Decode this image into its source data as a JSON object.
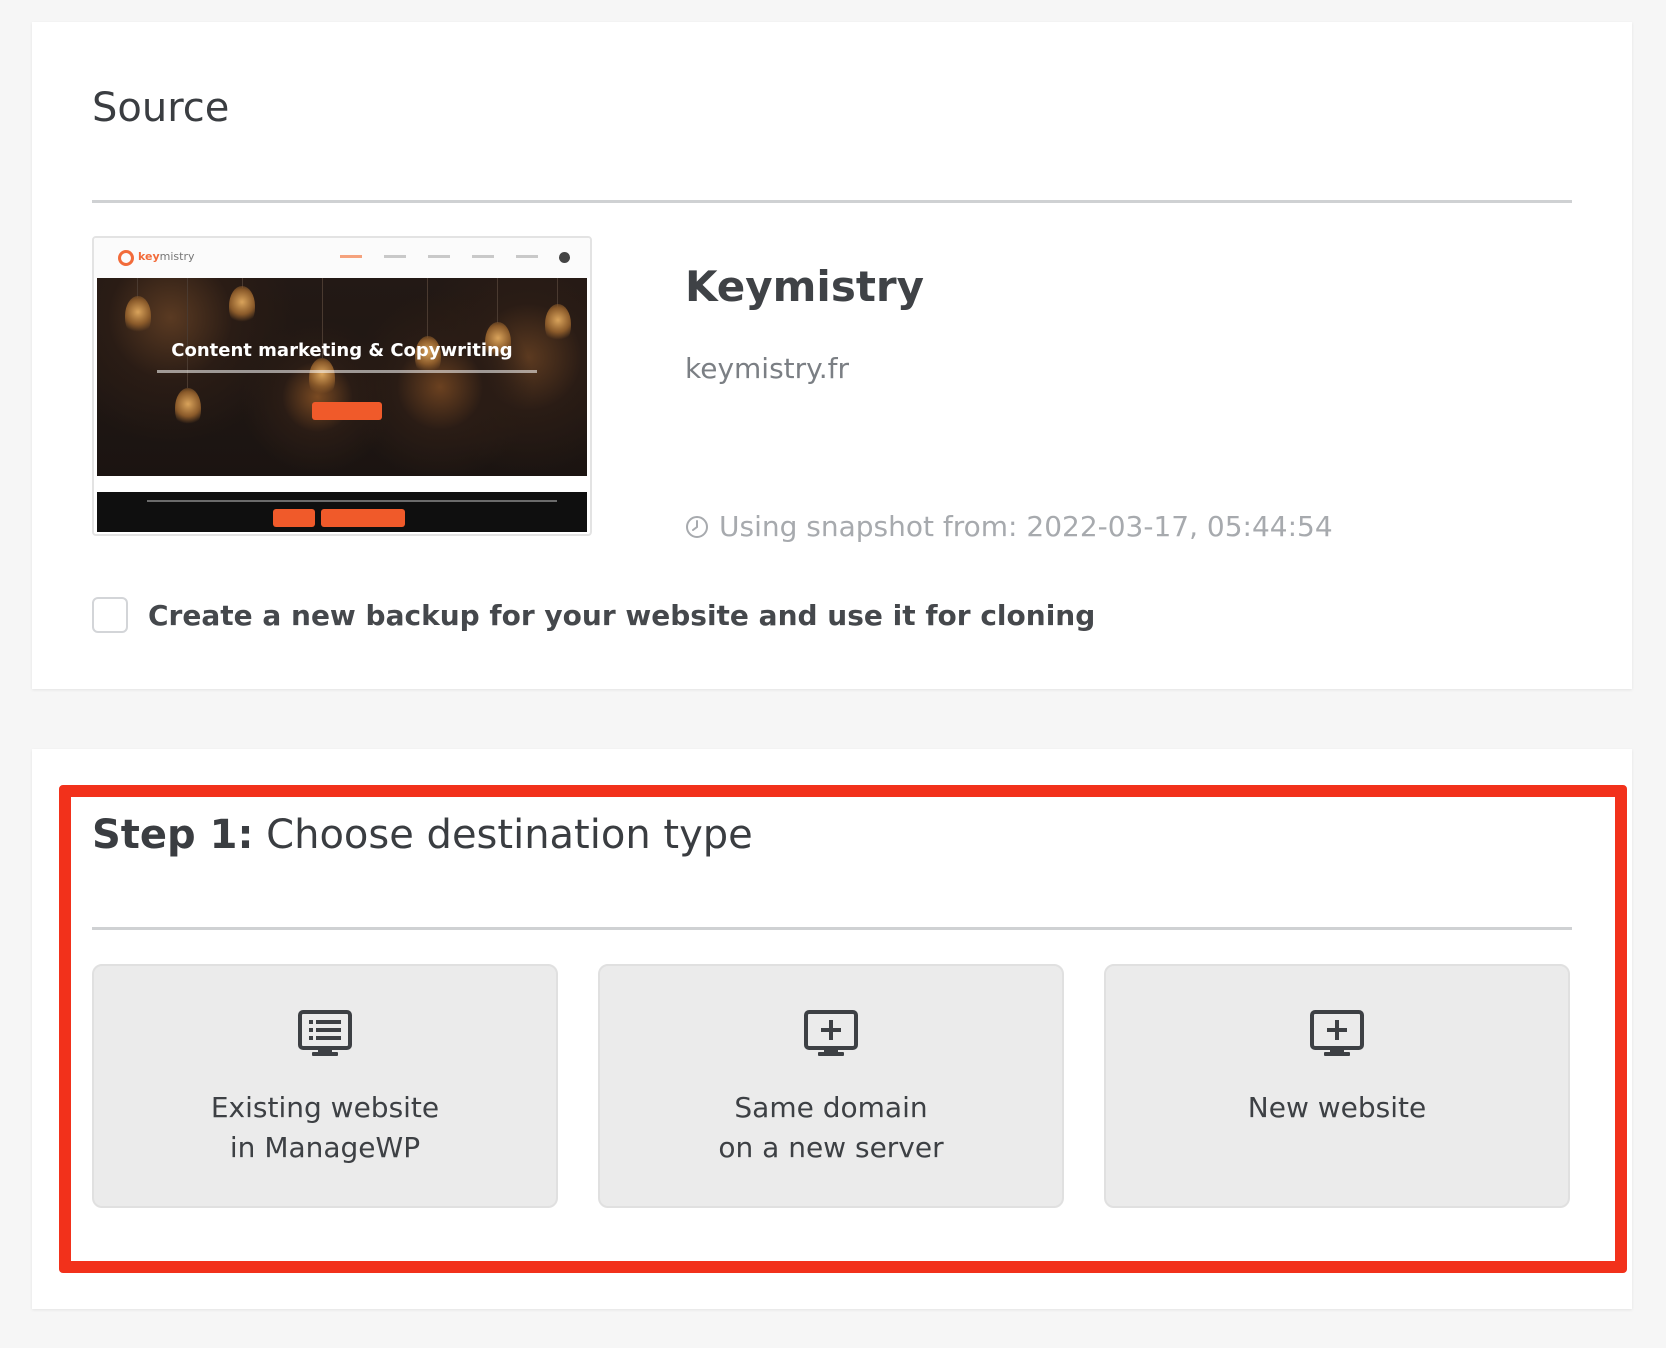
{
  "source": {
    "title": "Source",
    "site_name": "Keymistry",
    "domain": "keymistry.fr",
    "snapshot_text": "Using snapshot from: 2022-03-17, 05:44:54",
    "backup_checkbox": {
      "label": "Create a new backup for your website and use it for cloning",
      "checked": false
    },
    "thumbnail": {
      "logo_prefix": "key",
      "logo_suffix": "mistry",
      "headline": "Content marketing & Copywriting"
    }
  },
  "step": {
    "title_bold": "Step 1:",
    "title_rest": " Choose destination type",
    "options": [
      {
        "icon": "list-monitor-icon",
        "line1": "Existing website",
        "line2": "in ManageWP"
      },
      {
        "icon": "add-monitor-icon",
        "line1": "Same domain",
        "line2": "on a new server"
      },
      {
        "icon": "add-monitor-icon",
        "line1": "New website",
        "line2": ""
      }
    ]
  },
  "colors": {
    "highlight": "#f2311b",
    "accent": "#f05a2a",
    "option_bg": "#ebebeb"
  }
}
